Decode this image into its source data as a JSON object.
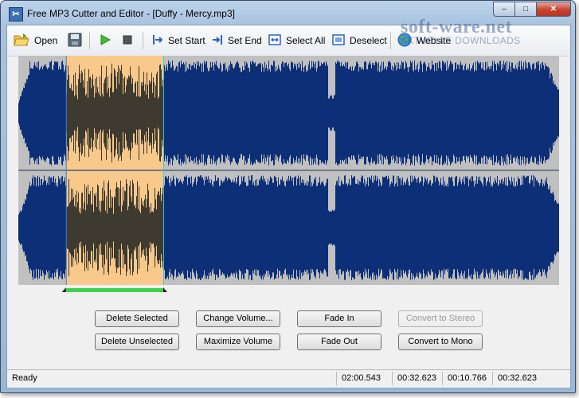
{
  "window": {
    "title": "Free MP3 Cutter and Editor - [Duffy - Mercy.mp3]",
    "caption_buttons": {
      "minimize": "–",
      "maximize": "□",
      "close": "✕"
    }
  },
  "toolbar": {
    "items": [
      {
        "label": "Open",
        "icon": "open-folder-icon"
      },
      {
        "label": "",
        "icon": "save-icon"
      },
      {
        "label": "",
        "icon": "play-icon"
      },
      {
        "label": "",
        "icon": "stop-icon"
      },
      {
        "label": "Set Start",
        "icon": "set-start-icon"
      },
      {
        "label": "Set End",
        "icon": "set-end-icon"
      },
      {
        "label": "Select All",
        "icon": "select-all-icon"
      },
      {
        "label": "Deselect",
        "icon": "deselect-icon"
      },
      {
        "label": "Website",
        "icon": "globe-icon"
      }
    ]
  },
  "waveform": {
    "colors": {
      "background": "#c0c0c0",
      "wave": "#0d2f77",
      "selection": "#f9c98c",
      "selection_wave": "#3e3a30",
      "selection_handle": "#3fcf4f"
    },
    "selection_fraction": {
      "start": 0.088,
      "end": 0.268
    }
  },
  "actions": {
    "delete_selected": "Delete Selected",
    "change_volume": "Change Volume...",
    "fade_in": "Fade In",
    "convert_to_stereo": "Convert to Stereo",
    "delete_unselected": "Delete Unselected",
    "maximize_volume": "Maximize Volume",
    "fade_out": "Fade Out",
    "convert_to_mono": "Convert to Mono"
  },
  "status": {
    "ready": "Ready",
    "values": [
      "02:00.543",
      "00:32.623",
      "00:10.766",
      "00:32.623"
    ]
  },
  "watermark": {
    "main": "soft-ware.net",
    "sub": "AKTUELLE DOWNLOADS"
  }
}
